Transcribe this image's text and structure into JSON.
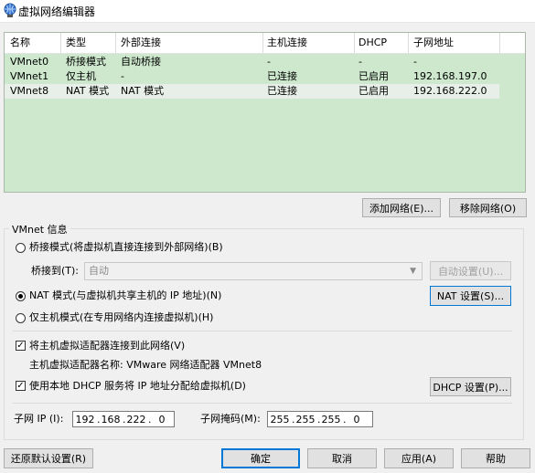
{
  "window": {
    "title": "虚拟网络编辑器"
  },
  "table": {
    "columns": [
      "名称",
      "类型",
      "外部连接",
      "主机连接",
      "DHCP",
      "子网地址"
    ],
    "rows": [
      {
        "name": "VMnet0",
        "type": "桥接模式",
        "external": "自动桥接",
        "host": "-",
        "dhcp": "-",
        "subnet": "-"
      },
      {
        "name": "VMnet1",
        "type": "仅主机",
        "external": "-",
        "host": "已连接",
        "dhcp": "已启用",
        "subnet": "192.168.197.0"
      },
      {
        "name": "VMnet8",
        "type": "NAT 模式",
        "external": "NAT 模式",
        "host": "已连接",
        "dhcp": "已启用",
        "subnet": "192.168.222.0"
      }
    ]
  },
  "table_buttons": {
    "add": "添加网络(E)...",
    "remove": "移除网络(O)"
  },
  "vmnet_info": {
    "label": "VMnet 信息",
    "bridged_radio": "桥接模式(将虚拟机直接连接到外部网络)(B)",
    "bridged_to_label": "桥接到(T):",
    "bridged_to_value": "自动",
    "auto_settings": "自动设置(U)...",
    "nat_radio": "NAT 模式(与虚拟机共享主机的 IP 地址)(N)",
    "nat_settings": "NAT 设置(S)...",
    "hostonly_radio": "仅主机模式(在专用网络内连接虚拟机)(H)",
    "selected_mode": "nat",
    "connect_adapter": "将主机虚拟适配器连接到此网络(V)",
    "connect_adapter_checked": true,
    "adapter_name_label": "主机虚拟适配器名称: VMware 网络适配器 VMnet8",
    "use_dhcp": "使用本地 DHCP 服务将 IP 地址分配给虚拟机(D)",
    "use_dhcp_checked": true,
    "dhcp_settings": "DHCP 设置(P)...",
    "subnet_ip_label": "子网 IP (I):",
    "subnet_ip": [
      "192",
      "168",
      "222",
      "0"
    ],
    "subnet_mask_label": "子网掩码(M):",
    "subnet_mask": [
      "255",
      "255",
      "255",
      "0"
    ]
  },
  "footer": {
    "restore": "还原默认设置(R)",
    "ok": "确定",
    "cancel": "取消",
    "apply": "应用(A)",
    "help": "帮助"
  },
  "colors": {
    "table_bg": "#cde8cd",
    "accent": "#0078d7"
  }
}
